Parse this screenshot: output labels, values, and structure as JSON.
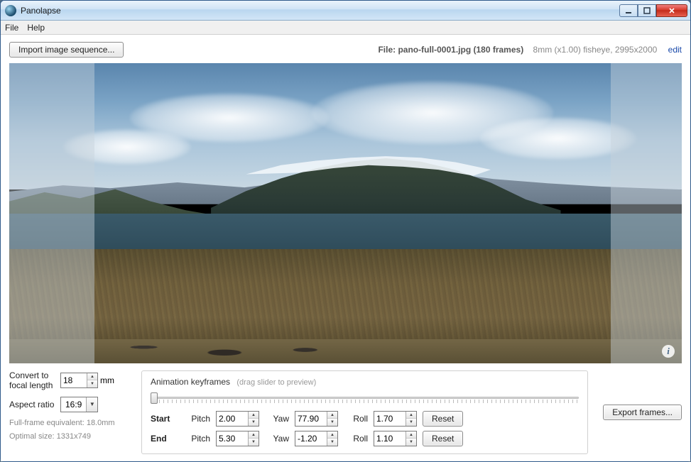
{
  "window": {
    "title": "Panolapse"
  },
  "menu": {
    "file": "File",
    "help": "Help"
  },
  "toolbar": {
    "import_label": "Import image sequence...",
    "file_label": "File: pano-full-0001.jpg (180 frames)",
    "lens_label": "8mm (x1.00) fisheye, 2995x2000",
    "edit_label": "edit"
  },
  "convert": {
    "label": "Convert to focal length",
    "value": "18",
    "unit": "mm"
  },
  "aspect": {
    "label": "Aspect ratio",
    "value": "16:9"
  },
  "info": {
    "ff_equiv": "Full-frame equivalent: 18.0mm",
    "optimal": "Optimal size: 1331x749"
  },
  "keyframes": {
    "title": "Animation keyframes",
    "hint": "(drag slider to preview)",
    "start_label": "Start",
    "end_label": "End",
    "pitch_label": "Pitch",
    "yaw_label": "Yaw",
    "roll_label": "Roll",
    "reset_label": "Reset",
    "start": {
      "pitch": "2.00",
      "yaw": "77.90",
      "roll": "1.70"
    },
    "end": {
      "pitch": "5.30",
      "yaw": "-1.20",
      "roll": "1.10"
    }
  },
  "export": {
    "label": "Export frames..."
  }
}
